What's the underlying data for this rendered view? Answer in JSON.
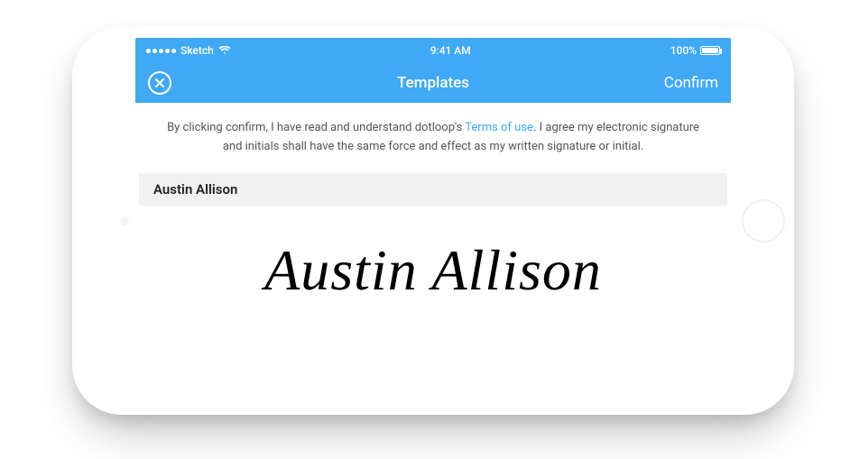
{
  "statusBar": {
    "carrier": "Sketch",
    "time": "9:41 AM",
    "batteryPercent": "100%"
  },
  "navBar": {
    "title": "Templates",
    "confirmLabel": "Confirm"
  },
  "disclaimer": {
    "pre": "By clicking confirm, I have read and understand dotloop's ",
    "linkText": "Terms of use",
    "post": ". I agree my electronic signature and initials shall have the same force and effect as my written signature or initial."
  },
  "signer": {
    "name": "Austin Allison",
    "signature": "Austin Allison"
  }
}
